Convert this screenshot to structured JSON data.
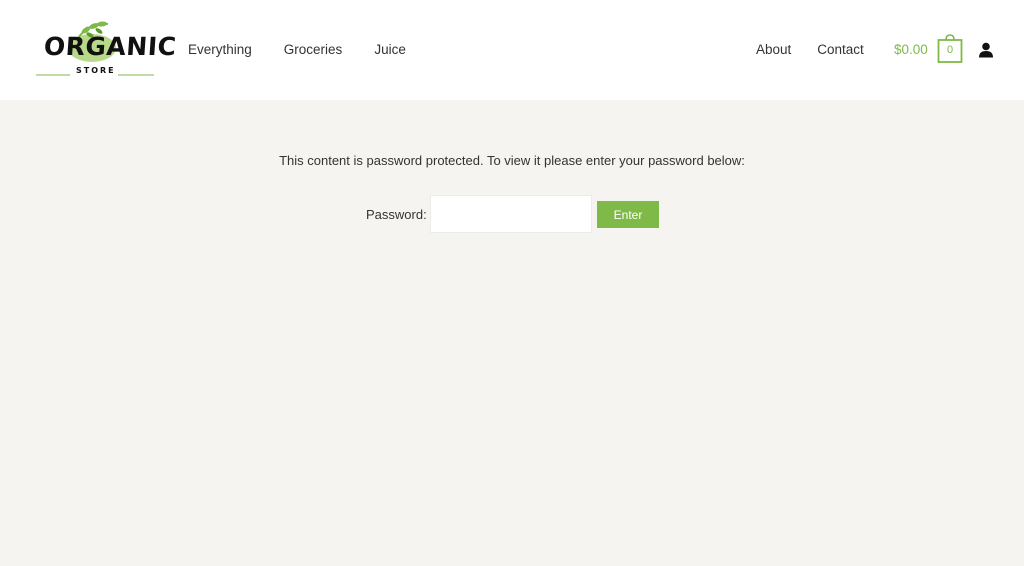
{
  "header": {
    "logo": {
      "word": "ORGANIC",
      "sub": "STORE"
    },
    "nav_left": [
      "Everything",
      "Groceries",
      "Juice"
    ],
    "nav_right": [
      "About",
      "Contact"
    ],
    "cart": {
      "total": "$0.00",
      "count": "0"
    },
    "account_icon": "user-icon"
  },
  "main": {
    "message": "This content is password protected. To view it please enter your password below:",
    "password_label": "Password:",
    "password_value": "",
    "submit_label": "Enter"
  },
  "colors": {
    "accent": "#7fba49",
    "background": "#f5f4f1",
    "header_bg": "#ffffff"
  }
}
